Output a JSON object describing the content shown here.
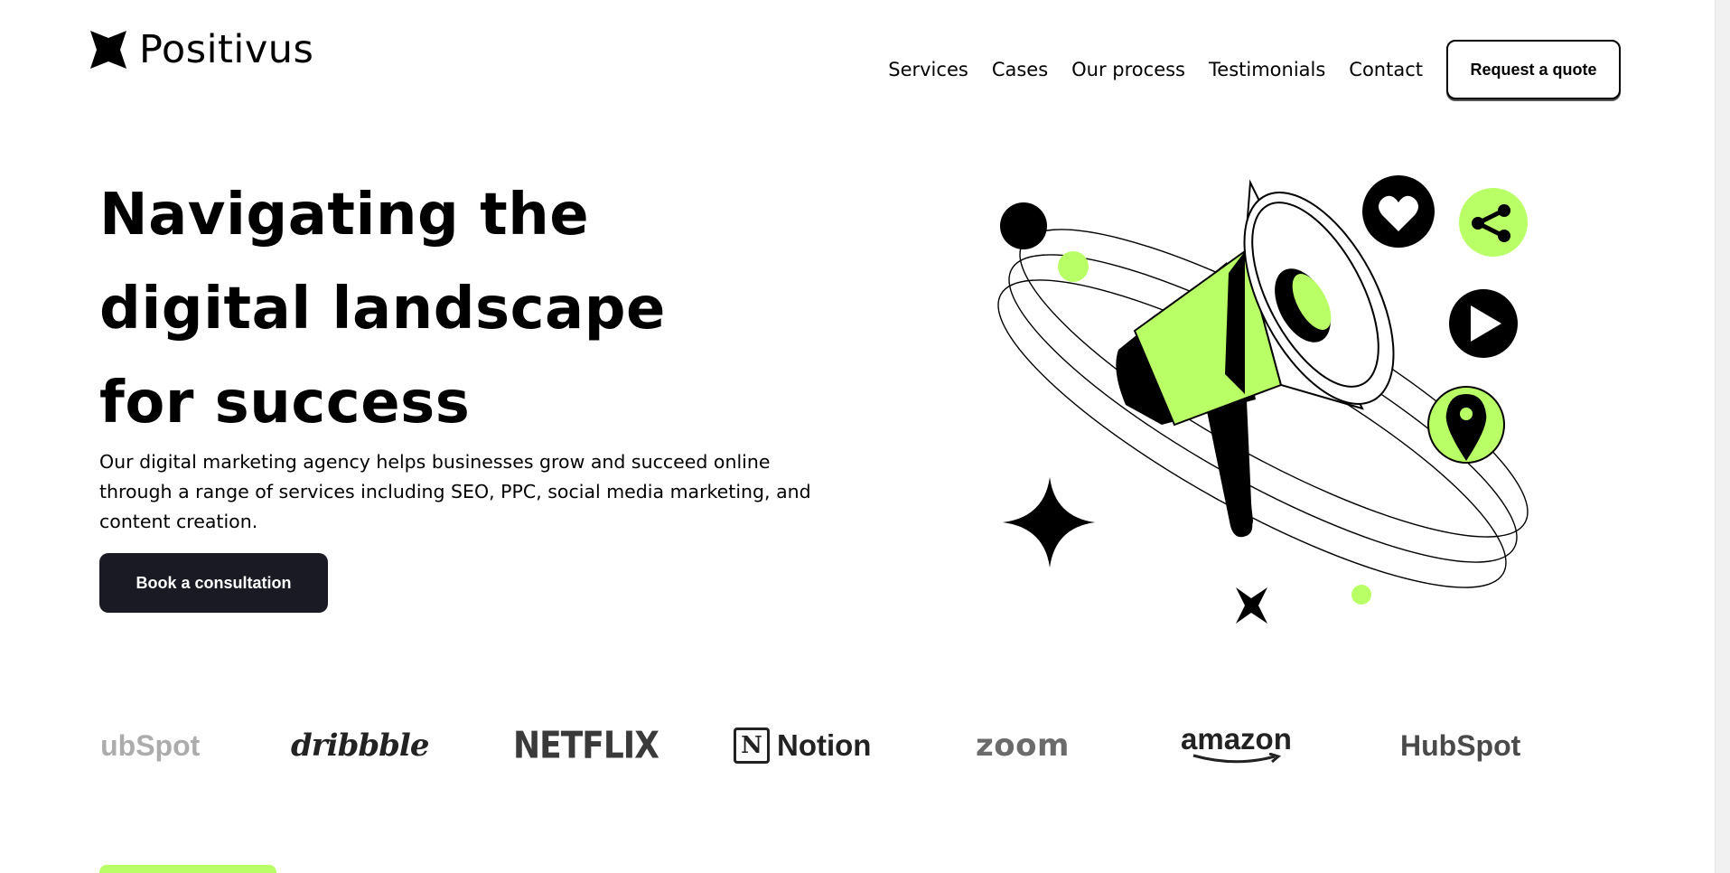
{
  "header": {
    "logo_text": "Positivus",
    "nav": [
      "Services",
      "Cases",
      "Our process",
      "Testimonials",
      "Contact"
    ],
    "quote_button": "Request a quote"
  },
  "hero": {
    "title_lines": [
      "Navigating the",
      "digital landscape",
      "for success"
    ],
    "description": "Our digital marketing agency helps businesses grow and succeed online through a range of services including SEO, PPC, social media marketing, and content creation.",
    "cta_button": "Book a consultation"
  },
  "illustration": {
    "icons": [
      "megaphone-icon",
      "heart-icon",
      "share-icon",
      "play-icon",
      "location-pin-icon",
      "sparkle-icon",
      "star-icon"
    ],
    "accent_color": "#b9ff66",
    "dark_color": "#000000"
  },
  "logos": {
    "hubspot": "HubSpot",
    "dribbble": "dribbble",
    "netflix": "NETFLIX",
    "notion_icon": "N",
    "notion": "Notion",
    "zoom": "zoom",
    "amazon": "amazon"
  },
  "colors": {
    "accent": "#b9ff66",
    "dark": "#191a23"
  }
}
